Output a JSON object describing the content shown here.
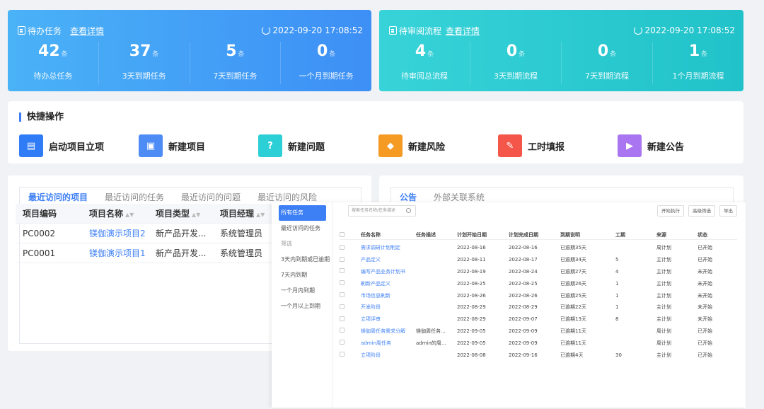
{
  "todo": {
    "title": "待办任务",
    "link": "查看详情",
    "timestamp": "2022-09-20 17:08:52",
    "stats": [
      {
        "value": "42",
        "unit": "条",
        "label": "待办总任务"
      },
      {
        "value": "37",
        "unit": "条",
        "label": "3天到期任务"
      },
      {
        "value": "5",
        "unit": "条",
        "label": "7天到期任务"
      },
      {
        "value": "0",
        "unit": "条",
        "label": "一个月到期任务"
      }
    ]
  },
  "review": {
    "title": "待审阅流程",
    "link": "查看详情",
    "timestamp": "2022-09-20 17:08:52",
    "stats": [
      {
        "value": "4",
        "unit": "条",
        "label": "待审阅总流程"
      },
      {
        "value": "0",
        "unit": "条",
        "label": "3天到期流程"
      },
      {
        "value": "0",
        "unit": "条",
        "label": "7天到期流程"
      },
      {
        "value": "1",
        "unit": "条",
        "label": "1个月到期流程"
      }
    ]
  },
  "quick": {
    "title": "快捷操作",
    "items": [
      {
        "label": "启动项目立项",
        "icon": "document-icon",
        "color": "#2f7cf6"
      },
      {
        "label": "新建项目",
        "icon": "file-icon",
        "color": "#4d8cf5"
      },
      {
        "label": "新建问题",
        "icon": "question-icon",
        "color": "#2ccfd6"
      },
      {
        "label": "新建风险",
        "icon": "shield-icon",
        "color": "#f59a23"
      },
      {
        "label": "工时填报",
        "icon": "edit-icon",
        "color": "#f5564a"
      },
      {
        "label": "新建公告",
        "icon": "speaker-icon",
        "color": "#a975f0"
      }
    ]
  },
  "recent": {
    "tabs": [
      "最近访问的项目",
      "最近访问的任务",
      "最近访问的问题",
      "最近访问的风险"
    ],
    "columns": [
      "项目编码",
      "项目名称",
      "项目类型",
      "项目经理"
    ],
    "rows": [
      [
        "PC0002",
        "镁伽演示项目2",
        "新产品开发...",
        "系统管理员"
      ],
      [
        "PC0001",
        "镁伽演示项目1",
        "新产品开发...",
        "系统管理员"
      ]
    ]
  },
  "notice": {
    "tabs": [
      "公告",
      "外部关联系统"
    ]
  },
  "taskPanel": {
    "side": {
      "active": "所有任务",
      "recent": "最近访问的任务",
      "filter_label": "筛选",
      "filters": [
        "3天内到期或已逾期",
        "7天内到期",
        "一个月内到期",
        "一个月以上到期"
      ]
    },
    "search_placeholder": "搜索任务名称/任务描述",
    "buttons": [
      "开始执行",
      "高级筛选",
      "导出"
    ],
    "columns": [
      "任务名称",
      "任务描述",
      "计划开始日期",
      "计划完成日期",
      "到期说明",
      "工期",
      "来源",
      "状态"
    ],
    "rows": [
      [
        "需求调研计划制定",
        "",
        "2022-08-16",
        "2022-08-16",
        "已逾期35天",
        "",
        "周计划",
        "已开始"
      ],
      [
        "产品定义",
        "",
        "2022-08-11",
        "2022-08-17",
        "已逾期34天",
        "5",
        "主计划",
        "已开始"
      ],
      [
        "编写产品业务计划书",
        "",
        "2022-08-19",
        "2022-08-24",
        "已逾期27天",
        "4",
        "主计划",
        "未开始"
      ],
      [
        "刷新产品定义",
        "",
        "2022-08-25",
        "2022-08-25",
        "已逾期26天",
        "1",
        "主计划",
        "未开始"
      ],
      [
        "市场信息刷新",
        "",
        "2022-08-26",
        "2022-08-26",
        "已逾期25天",
        "1",
        "主计划",
        "未开始"
      ],
      [
        "开发阶段",
        "",
        "2022-08-29",
        "2022-08-29",
        "已逾期22天",
        "1",
        "主计划",
        "未开始"
      ],
      [
        "立项评审",
        "",
        "2022-08-29",
        "2022-09-07",
        "已逾期13天",
        "8",
        "主计划",
        "未开始"
      ],
      [
        "镁伽周任务需求分解",
        "镁伽周任务...",
        "2022-09-05",
        "2022-09-09",
        "已逾期11天",
        "",
        "周计划",
        "已开始"
      ],
      [
        "admin周任务",
        "admin的周...",
        "2022-09-05",
        "2022-09-09",
        "已逾期11天",
        "",
        "周计划",
        "已开始"
      ],
      [
        "立项阶段",
        "",
        "2022-08-08",
        "2022-09-16",
        "已逾期4天",
        "30",
        "主计划",
        "已开始"
      ]
    ]
  }
}
